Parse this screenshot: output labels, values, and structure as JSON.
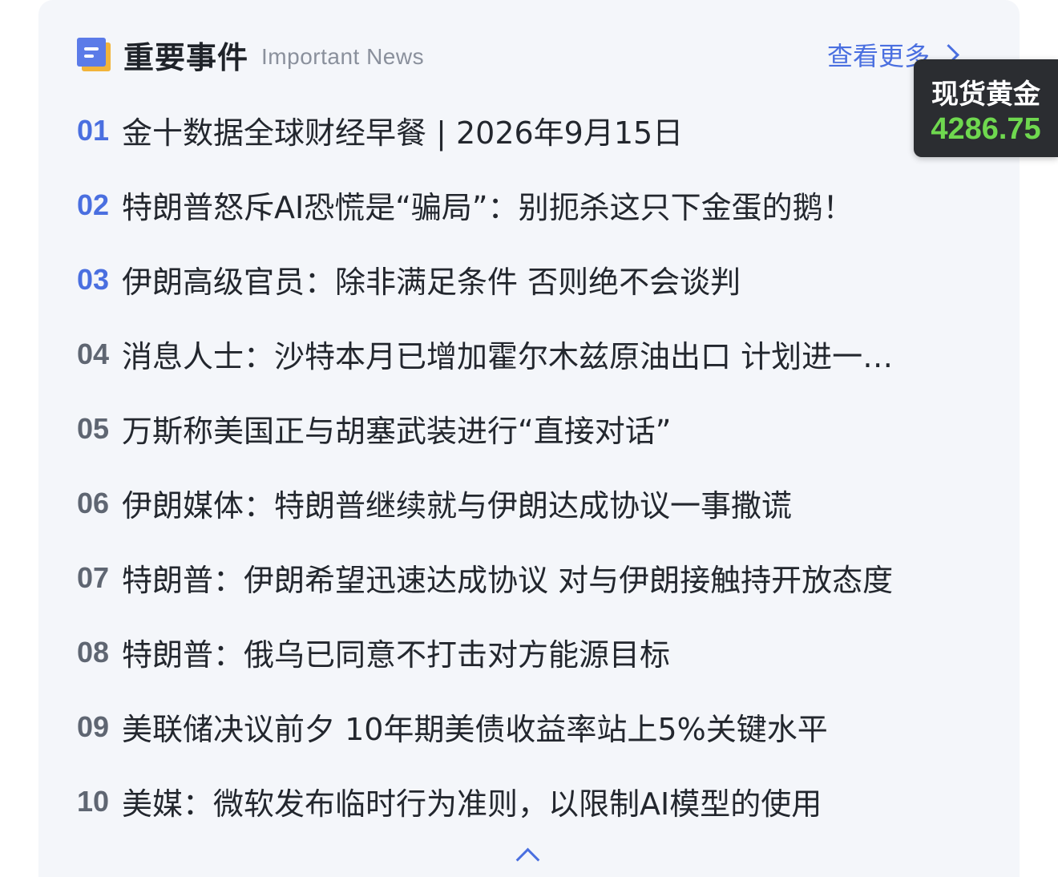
{
  "header": {
    "title_cn": "重要事件",
    "title_en": "Important News",
    "more_label": "查看更多"
  },
  "news": [
    {
      "num": "01",
      "text": "金十数据全球财经早餐 | 2026年9月15日"
    },
    {
      "num": "02",
      "text": "特朗普怒斥AI恐慌是“骗局”：别扼杀这只下金蛋的鹅！"
    },
    {
      "num": "03",
      "text": "伊朗高级官员：除非满足条件 否则绝不会谈判"
    },
    {
      "num": "04",
      "text": "消息人士：沙特本月已增加霍尔木兹原油出口 计划进一…"
    },
    {
      "num": "05",
      "text": "万斯称美国正与胡塞武装进行“直接对话”"
    },
    {
      "num": "06",
      "text": "伊朗媒体：特朗普继续就与伊朗达成协议一事撒谎"
    },
    {
      "num": "07",
      "text": "特朗普：伊朗希望迅速达成协议 对与伊朗接触持开放态度"
    },
    {
      "num": "08",
      "text": "特朗普：俄乌已同意不打击对方能源目标"
    },
    {
      "num": "09",
      "text": "美联储决议前夕 10年期美债收益率站上5%关键水平"
    },
    {
      "num": "10",
      "text": "美媒：微软发布临时行为准则，以限制AI模型的使用"
    }
  ],
  "gold": {
    "label": "现货黄金",
    "price": "4286.75"
  },
  "colors": {
    "accent": "#4a6fe0",
    "background": "#f4f6fa",
    "price_up": "#6fd84f",
    "icon_front": "#5b7be8",
    "icon_back": "#f2b43a"
  },
  "icons": {
    "logo": "news-document-icon",
    "more": "chevron-right-icon",
    "collapse": "chevron-up-icon"
  }
}
